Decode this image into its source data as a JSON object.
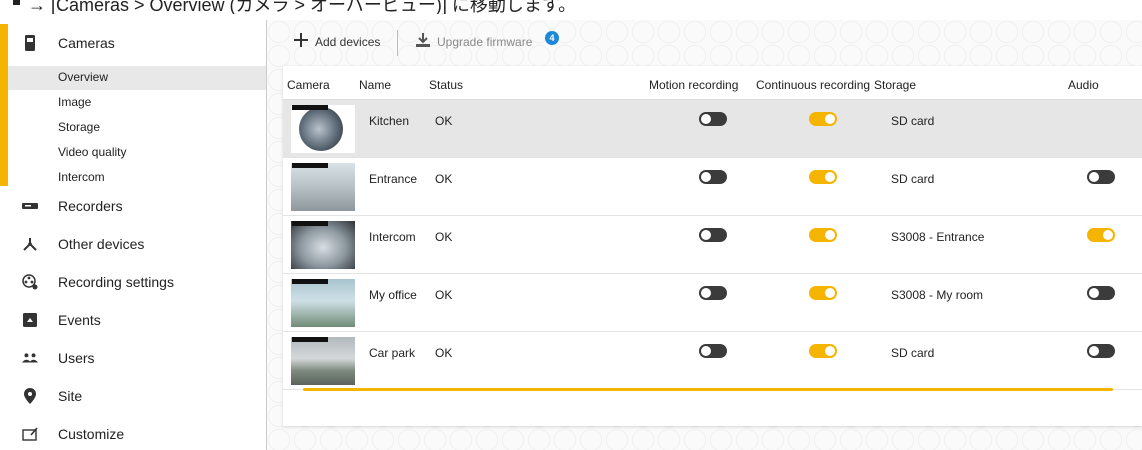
{
  "caption": "→ [Cameras > Overview (カメラ > オーバービュー)] に移動します。",
  "colors": {
    "accent": "#f5b400",
    "badge": "#1e88d8",
    "toggle_off": "#3b3b3b"
  },
  "sidebar": {
    "items": [
      {
        "label": "Cameras",
        "icon": "camera-icon"
      },
      {
        "label": "Recorders",
        "icon": "recorder-icon"
      },
      {
        "label": "Other devices",
        "icon": "other-devices-icon"
      },
      {
        "label": "Recording settings",
        "icon": "recording-settings-icon"
      },
      {
        "label": "Events",
        "icon": "events-icon"
      },
      {
        "label": "Users",
        "icon": "users-icon"
      },
      {
        "label": "Site",
        "icon": "location-pin-icon"
      },
      {
        "label": "Customize",
        "icon": "customize-icon"
      }
    ],
    "sub_items": [
      {
        "label": "Overview",
        "active": true
      },
      {
        "label": "Image"
      },
      {
        "label": "Storage"
      },
      {
        "label": "Video quality"
      },
      {
        "label": "Intercom"
      }
    ]
  },
  "toolbar": {
    "add_devices": "Add devices",
    "upgrade_firmware": "Upgrade firmware",
    "upgrade_badge": "4"
  },
  "table": {
    "headers": [
      "Camera",
      "Name",
      "Status",
      "Motion recording",
      "Continuous recording",
      "Storage",
      "Audio"
    ],
    "rows": [
      {
        "name": "Kitchen",
        "status": "OK",
        "motion": false,
        "continuous": true,
        "storage": "SD card",
        "audio": null,
        "selected": true
      },
      {
        "name": "Entrance",
        "status": "OK",
        "motion": false,
        "continuous": true,
        "storage": "SD card",
        "audio": false
      },
      {
        "name": "Intercom",
        "status": "OK",
        "motion": false,
        "continuous": true,
        "storage": "S3008 - Entrance",
        "audio": true
      },
      {
        "name": "My office",
        "status": "OK",
        "motion": false,
        "continuous": true,
        "storage": "S3008 - My room",
        "audio": false
      },
      {
        "name": "Car park",
        "status": "OK",
        "motion": false,
        "continuous": true,
        "storage": "SD card",
        "audio": false
      }
    ]
  }
}
